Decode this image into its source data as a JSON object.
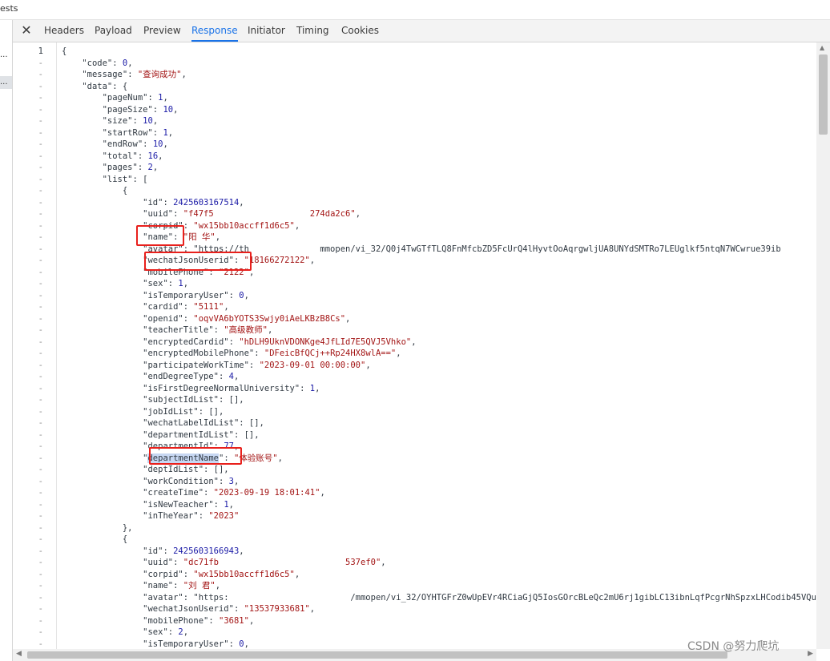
{
  "top_strip_text": "ests",
  "left_panel": {
    "row1": "...",
    "row2": "..."
  },
  "tabs": {
    "close_glyph": "✕",
    "items": [
      "Headers",
      "Payload",
      "Preview",
      "Response",
      "Initiator",
      "Timing",
      "Cookies"
    ],
    "active": "Response"
  },
  "colors": {
    "accent": "#1a73e8",
    "json_key": "#303942",
    "json_string": "#a31515",
    "json_number": "#1a1aa6",
    "highlight_box": "#e8201c"
  },
  "gutter": {
    "first_line_number": "1",
    "collapsed_marker": "-"
  },
  "code_lines": [
    "{",
    "    \"code\": 0,",
    "    \"message\": \"查询成功\",",
    "    \"data\": {",
    "        \"pageNum\": 1,",
    "        \"pageSize\": 10,",
    "        \"size\": 10,",
    "        \"startRow\": 1,",
    "        \"endRow\": 10,",
    "        \"total\": 16,",
    "        \"pages\": 2,",
    "        \"list\": [",
    "            {",
    "                \"id\": 2425603167514,",
    "                \"uuid\": \"f47f5                   274da2c6\",",
    "                \"corpid\": \"wx15bb10accff1d6c5\",",
    "                \"name\": \"阳 华\",",
    "                \"avatar\": \"https://th              mmopen/vi_32/Q0j4TwGTfTLQ8FnMfcbZD5FcUrQ4lHyvtOoAqrgwljUA8UNYdSMTRo7LEUglkf5ntqN7WCwrue39ib",
    "                \"wechatJsonUserid\": \"18166272122\",",
    "                \"mobilePhone\": \"2122\",",
    "                \"sex\": 1,",
    "                \"isTemporaryUser\": 0,",
    "                \"cardid\": \"5111\",",
    "                \"openid\": \"oqvVA6bYOTS3Swjy0iAeLKBzB8Cs\",",
    "                \"teacherTitle\": \"高级教师\",",
    "                \"encryptedCardid\": \"hDLH9UknVDONKge4JfLId7E5QVJ5Vhko\",",
    "                \"encryptedMobilePhone\": \"DFeicBfQCj++Rp24HX8wlA==\",",
    "                \"participateWorkTime\": \"2023-09-01 00:00:00\",",
    "                \"endDegreeType\": 4,",
    "                \"isFirstDegreeNormalUniversity\": 1,",
    "                \"subjectIdList\": [],",
    "                \"jobIdList\": [],",
    "                \"wechatLabelIdList\": [],",
    "                \"departmentIdList\": [],",
    "                \"departmentId\": 77,",
    "                \"departmentName\": \"体验账号\",",
    "                \"deptIdList\": [],",
    "                \"workCondition\": 3,",
    "                \"createTime\": \"2023-09-19 18:01:41\",",
    "                \"isNewTeacher\": 1,",
    "                \"inTheYear\": \"2023\"",
    "            },",
    "            {",
    "                \"id\": 2425603166943,",
    "                \"uuid\": \"dc71fb                         537ef0\",",
    "                \"corpid\": \"wx15bb10accff1d6c5\",",
    "                \"name\": \"刘 君\",",
    "                \"avatar\": \"https:                        /mmopen/vi_32/OYHTGFrZ0wUpEVr4RCiaGjQ5IosGOrcBLeQc2mU6rj1gibLC13ibnLqfPcgrNhSpzxLHCodib45VQu",
    "                \"wechatJsonUserid\": \"13537933681\",",
    "                \"mobilePhone\": \"3681\",",
    "                \"sex\": 2,",
    "                \"isTemporaryUser\": 0,"
  ],
  "watermark": "CSDN @努力爬坑"
}
